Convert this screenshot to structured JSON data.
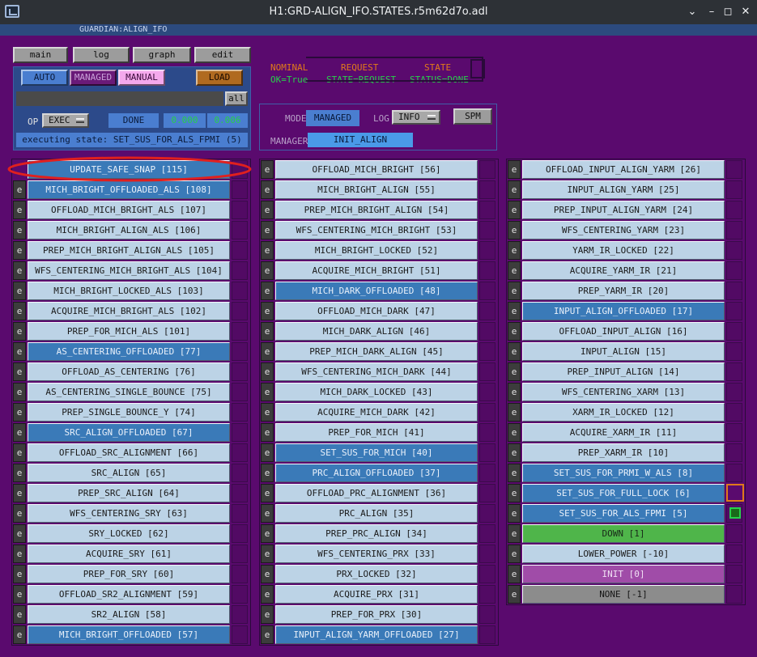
{
  "window": {
    "title": "H1:GRD-ALIGN_IFO.STATES.r5m62d7o.adl"
  },
  "guardian_label": "GUARDIAN:",
  "guardian_node": "ALIGN_IFO",
  "tabs": [
    "main",
    "log",
    "graph",
    "edit"
  ],
  "mode_buttons": {
    "auto": "AUTO",
    "managed": "MANAGED",
    "manual": "MANUAL",
    "load": "LOAD",
    "all": "all"
  },
  "op": {
    "label": "OP",
    "value": "EXEC",
    "status": "DONE",
    "num1": "0.000",
    "num2": "0.006"
  },
  "executing": "executing state: SET_SUS_FOR_ALS_FPMI (5)",
  "flow": {
    "nominal": "NOMINAL",
    "request": "REQUEST",
    "state": "STATE",
    "nominal_val": "OK=True",
    "request_val": "STATE=REQUEST",
    "state_val": "STATUS=DONE"
  },
  "mode_panel": {
    "mode_label": "MODE",
    "mode_value": "MANAGED",
    "log_label": "LOG",
    "log_value": "INFO",
    "spm": "SPM",
    "manager_label": "MANAGER",
    "manager_value": "INIT_ALIGN"
  },
  "colors": {
    "background": "#5a0a6e",
    "offloaded": "#3a7ab8",
    "normal": "#bcd3e6",
    "down": "#4fb54a",
    "init": "#a04ca8",
    "none": "#8c8c8c"
  },
  "columns": [
    [
      {
        "label": "UPDATE_SAFE_SNAP  [115]",
        "style": "offl",
        "no_e": true
      },
      {
        "label": "MICH_BRIGHT_OFFLOADED_ALS  [108]",
        "style": "offl"
      },
      {
        "label": "OFFLOAD_MICH_BRIGHT_ALS  [107]",
        "style": "normal"
      },
      {
        "label": "MICH_BRIGHT_ALIGN_ALS  [106]",
        "style": "normal"
      },
      {
        "label": "PREP_MICH_BRIGHT_ALIGN_ALS  [105]",
        "style": "normal"
      },
      {
        "label": "WFS_CENTERING_MICH_BRIGHT_ALS  [104]",
        "style": "normal"
      },
      {
        "label": "MICH_BRIGHT_LOCKED_ALS  [103]",
        "style": "normal"
      },
      {
        "label": "ACQUIRE_MICH_BRIGHT_ALS  [102]",
        "style": "normal"
      },
      {
        "label": "PREP_FOR_MICH_ALS  [101]",
        "style": "normal"
      },
      {
        "label": "AS_CENTERING_OFFLOADED  [77]",
        "style": "offl"
      },
      {
        "label": "OFFLOAD_AS_CENTERING  [76]",
        "style": "normal"
      },
      {
        "label": "AS_CENTERING_SINGLE_BOUNCE  [75]",
        "style": "normal"
      },
      {
        "label": "PREP_SINGLE_BOUNCE_Y  [74]",
        "style": "normal"
      },
      {
        "label": "SRC_ALIGN_OFFLOADED  [67]",
        "style": "offl"
      },
      {
        "label": "OFFLOAD_SRC_ALIGNMENT  [66]",
        "style": "normal"
      },
      {
        "label": "SRC_ALIGN  [65]",
        "style": "normal"
      },
      {
        "label": "PREP_SRC_ALIGN  [64]",
        "style": "normal"
      },
      {
        "label": "WFS_CENTERING_SRY  [63]",
        "style": "normal"
      },
      {
        "label": "SRY_LOCKED  [62]",
        "style": "normal"
      },
      {
        "label": "ACQUIRE_SRY  [61]",
        "style": "normal"
      },
      {
        "label": "PREP_FOR_SRY  [60]",
        "style": "normal"
      },
      {
        "label": "OFFLOAD_SR2_ALIGNMENT  [59]",
        "style": "normal"
      },
      {
        "label": "SR2_ALIGN  [58]",
        "style": "normal"
      },
      {
        "label": "MICH_BRIGHT_OFFLOADED  [57]",
        "style": "offl"
      }
    ],
    [
      {
        "label": "OFFLOAD_MICH_BRIGHT  [56]",
        "style": "normal"
      },
      {
        "label": "MICH_BRIGHT_ALIGN  [55]",
        "style": "normal"
      },
      {
        "label": "PREP_MICH_BRIGHT_ALIGN  [54]",
        "style": "normal"
      },
      {
        "label": "WFS_CENTERING_MICH_BRIGHT  [53]",
        "style": "normal"
      },
      {
        "label": "MICH_BRIGHT_LOCKED  [52]",
        "style": "normal"
      },
      {
        "label": "ACQUIRE_MICH_BRIGHT  [51]",
        "style": "normal"
      },
      {
        "label": "MICH_DARK_OFFLOADED  [48]",
        "style": "offl"
      },
      {
        "label": "OFFLOAD_MICH_DARK  [47]",
        "style": "normal"
      },
      {
        "label": "MICH_DARK_ALIGN  [46]",
        "style": "normal"
      },
      {
        "label": "PREP_MICH_DARK_ALIGN  [45]",
        "style": "normal"
      },
      {
        "label": "WFS_CENTERING_MICH_DARK  [44]",
        "style": "normal"
      },
      {
        "label": "MICH_DARK_LOCKED  [43]",
        "style": "normal"
      },
      {
        "label": "ACQUIRE_MICH_DARK  [42]",
        "style": "normal"
      },
      {
        "label": "PREP_FOR_MICH  [41]",
        "style": "normal"
      },
      {
        "label": "SET_SUS_FOR_MICH  [40]",
        "style": "offl"
      },
      {
        "label": "PRC_ALIGN_OFFLOADED  [37]",
        "style": "offl"
      },
      {
        "label": "OFFLOAD_PRC_ALIGNMENT  [36]",
        "style": "normal"
      },
      {
        "label": "PRC_ALIGN  [35]",
        "style": "normal"
      },
      {
        "label": "PREP_PRC_ALIGN  [34]",
        "style": "normal"
      },
      {
        "label": "WFS_CENTERING_PRX  [33]",
        "style": "normal"
      },
      {
        "label": "PRX_LOCKED  [32]",
        "style": "normal"
      },
      {
        "label": "ACQUIRE_PRX  [31]",
        "style": "normal"
      },
      {
        "label": "PREP_FOR_PRX  [30]",
        "style": "normal"
      },
      {
        "label": "INPUT_ALIGN_YARM_OFFLOADED  [27]",
        "style": "offl"
      }
    ],
    [
      {
        "label": "OFFLOAD_INPUT_ALIGN_YARM  [26]",
        "style": "normal"
      },
      {
        "label": "INPUT_ALIGN_YARM  [25]",
        "style": "normal"
      },
      {
        "label": "PREP_INPUT_ALIGN_YARM  [24]",
        "style": "normal"
      },
      {
        "label": "WFS_CENTERING_YARM  [23]",
        "style": "normal"
      },
      {
        "label": "YARM_IR_LOCKED  [22]",
        "style": "normal"
      },
      {
        "label": "ACQUIRE_YARM_IR  [21]",
        "style": "normal"
      },
      {
        "label": "PREP_YARM_IR  [20]",
        "style": "normal"
      },
      {
        "label": "INPUT_ALIGN_OFFLOADED  [17]",
        "style": "offl"
      },
      {
        "label": "OFFLOAD_INPUT_ALIGN  [16]",
        "style": "normal"
      },
      {
        "label": "INPUT_ALIGN  [15]",
        "style": "normal"
      },
      {
        "label": "PREP_INPUT_ALIGN  [14]",
        "style": "normal"
      },
      {
        "label": "WFS_CENTERING_XARM  [13]",
        "style": "normal"
      },
      {
        "label": "XARM_IR_LOCKED  [12]",
        "style": "normal"
      },
      {
        "label": "ACQUIRE_XARM_IR  [11]",
        "style": "normal"
      },
      {
        "label": "PREP_XARM_IR  [10]",
        "style": "normal"
      },
      {
        "label": "SET_SUS_FOR_PRMI_W_ALS  [8]",
        "style": "offl"
      },
      {
        "label": "SET_SUS_FOR_FULL_LOCK  [6]",
        "style": "offl",
        "marker": "request"
      },
      {
        "label": "SET_SUS_FOR_ALS_FPMI  [5]",
        "style": "offl",
        "marker": "state"
      },
      {
        "label": "DOWN  [1]",
        "style": "down"
      },
      {
        "label": "LOWER_POWER  [-10]",
        "style": "normal"
      },
      {
        "label": "INIT  [0]",
        "style": "init"
      },
      {
        "label": "NONE  [-1]",
        "style": "none"
      }
    ]
  ],
  "e_label": "e"
}
